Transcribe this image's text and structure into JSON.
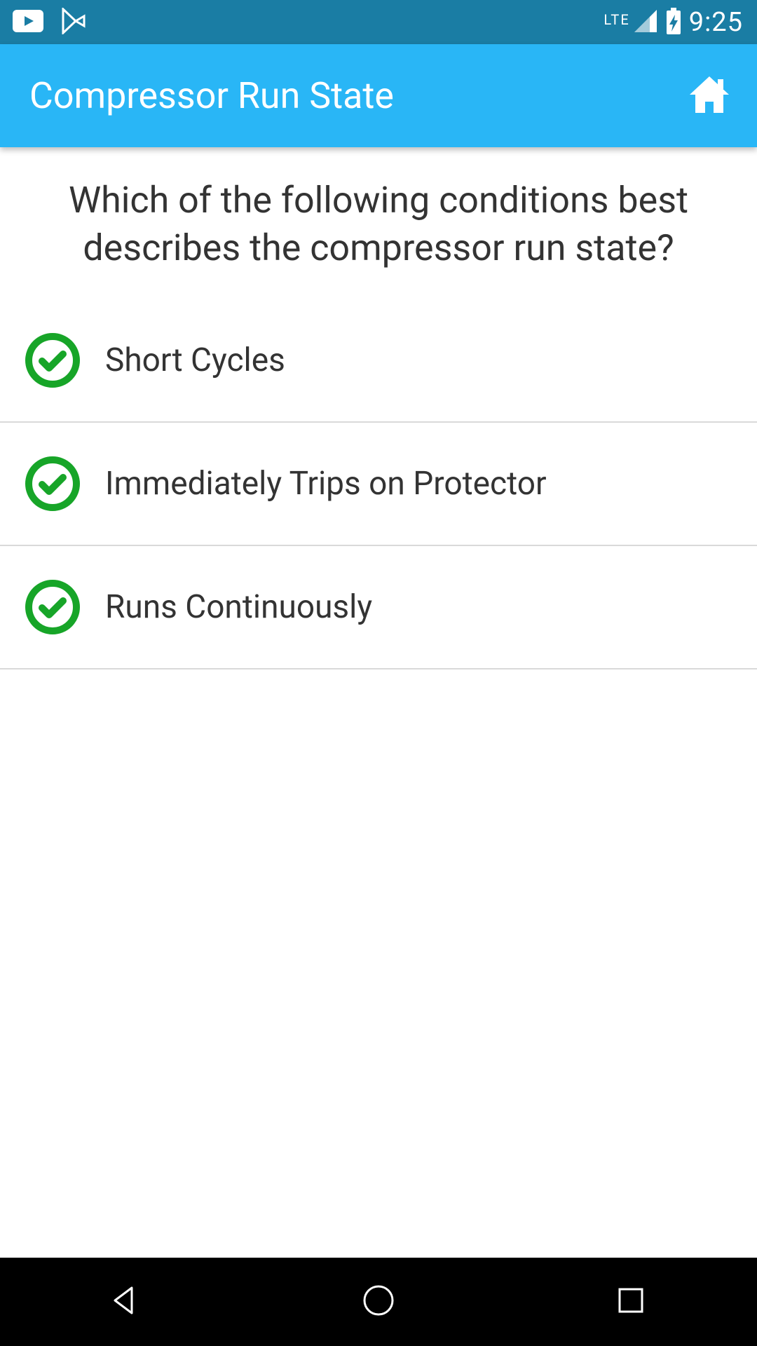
{
  "statusbar": {
    "network": "LTE",
    "time": "9:25"
  },
  "appbar": {
    "title": "Compressor Run State"
  },
  "question": "Which of the following conditions best describes the compressor run state?",
  "options": [
    {
      "label": "Short Cycles"
    },
    {
      "label": "Immediately Trips on Protector"
    },
    {
      "label": "Runs Continuously"
    }
  ],
  "colors": {
    "statusbar": "#1a7da4",
    "appbar": "#29b6f6",
    "option_icon": "#2e7d32"
  }
}
